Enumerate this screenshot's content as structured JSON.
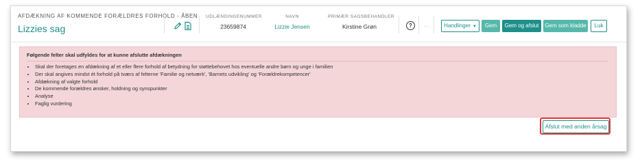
{
  "header": {
    "case_subtitle": "AFDÆKNING AF KOMMENDE FORÆLDRES FORHOLD - ÅBEN",
    "case_title": "Lizzies sag",
    "fields": [
      {
        "label": "UDLÆNDINGENUMMER",
        "value": "23659874"
      },
      {
        "label": "NAVN",
        "value": "Lizzie Jensen"
      },
      {
        "label": "PRIMÆR SAGSBEHANDLER",
        "value": "Kirstine Grøn"
      }
    ],
    "help_icon": "?",
    "more_icon": "…",
    "buttons": {
      "actions": "Handlinger",
      "save": "Gem",
      "save_close": "Gem og afslut",
      "save_draft": "Gem som kladde",
      "close": "Luk"
    },
    "icons": [
      "pencil-icon",
      "document-icon",
      "help-icon",
      "ellipsis-icon",
      "caret-down-icon"
    ]
  },
  "alert": {
    "title": "Følgende felter skal udfyldes for at kunne afslutte afdækningen",
    "items": [
      "Skal der foretages en afdækning af et eller flere forhold af betydning for støttebehovet hos eventuelle andre børn og unge i familien",
      "Der skal angives mindst ét forhold på tværs af felterne 'Familie og netværk', 'Barnets udvikling' og 'Forældrekompetencer'",
      "Afdækning af valgte forhold",
      "De kommende forældres ønsker, holdning og synspunkter",
      "Analyse",
      "Faglig vurdering"
    ]
  },
  "footer": {
    "close_with_reason": "Afslut med anden årsag"
  },
  "colors": {
    "accent": "#1e8f8a",
    "button_fill": "#55b8aa",
    "alert_bg": "#f4d6d9",
    "highlight": "#e23a3a"
  }
}
